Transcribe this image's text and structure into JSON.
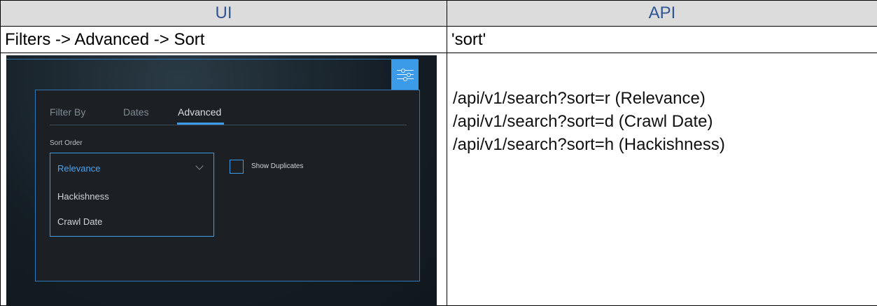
{
  "table": {
    "header_ui": "UI",
    "header_api": "API",
    "ui_path": "Filters -> Advanced -> Sort",
    "api_param": "'sort'",
    "api_lines": [
      "/api/v1/search?sort=r (Relevance)",
      "/api/v1/search?sort=d (Crawl Date)",
      "/api/v1/search?sort=h (Hackishness)"
    ]
  },
  "screenshot": {
    "tabs": [
      "Filter By",
      "Dates",
      "Advanced"
    ],
    "active_tab": "Advanced",
    "sort_label": "Sort Order",
    "selected_value": "Relevance",
    "options": [
      "Hackishness",
      "Crawl Date"
    ],
    "checkbox_label": "Show Duplicates",
    "checkbox_checked": false,
    "accent_color": "#3c9be8",
    "icons": [
      "filter-sliders-icon",
      "chevron-down-icon"
    ]
  }
}
